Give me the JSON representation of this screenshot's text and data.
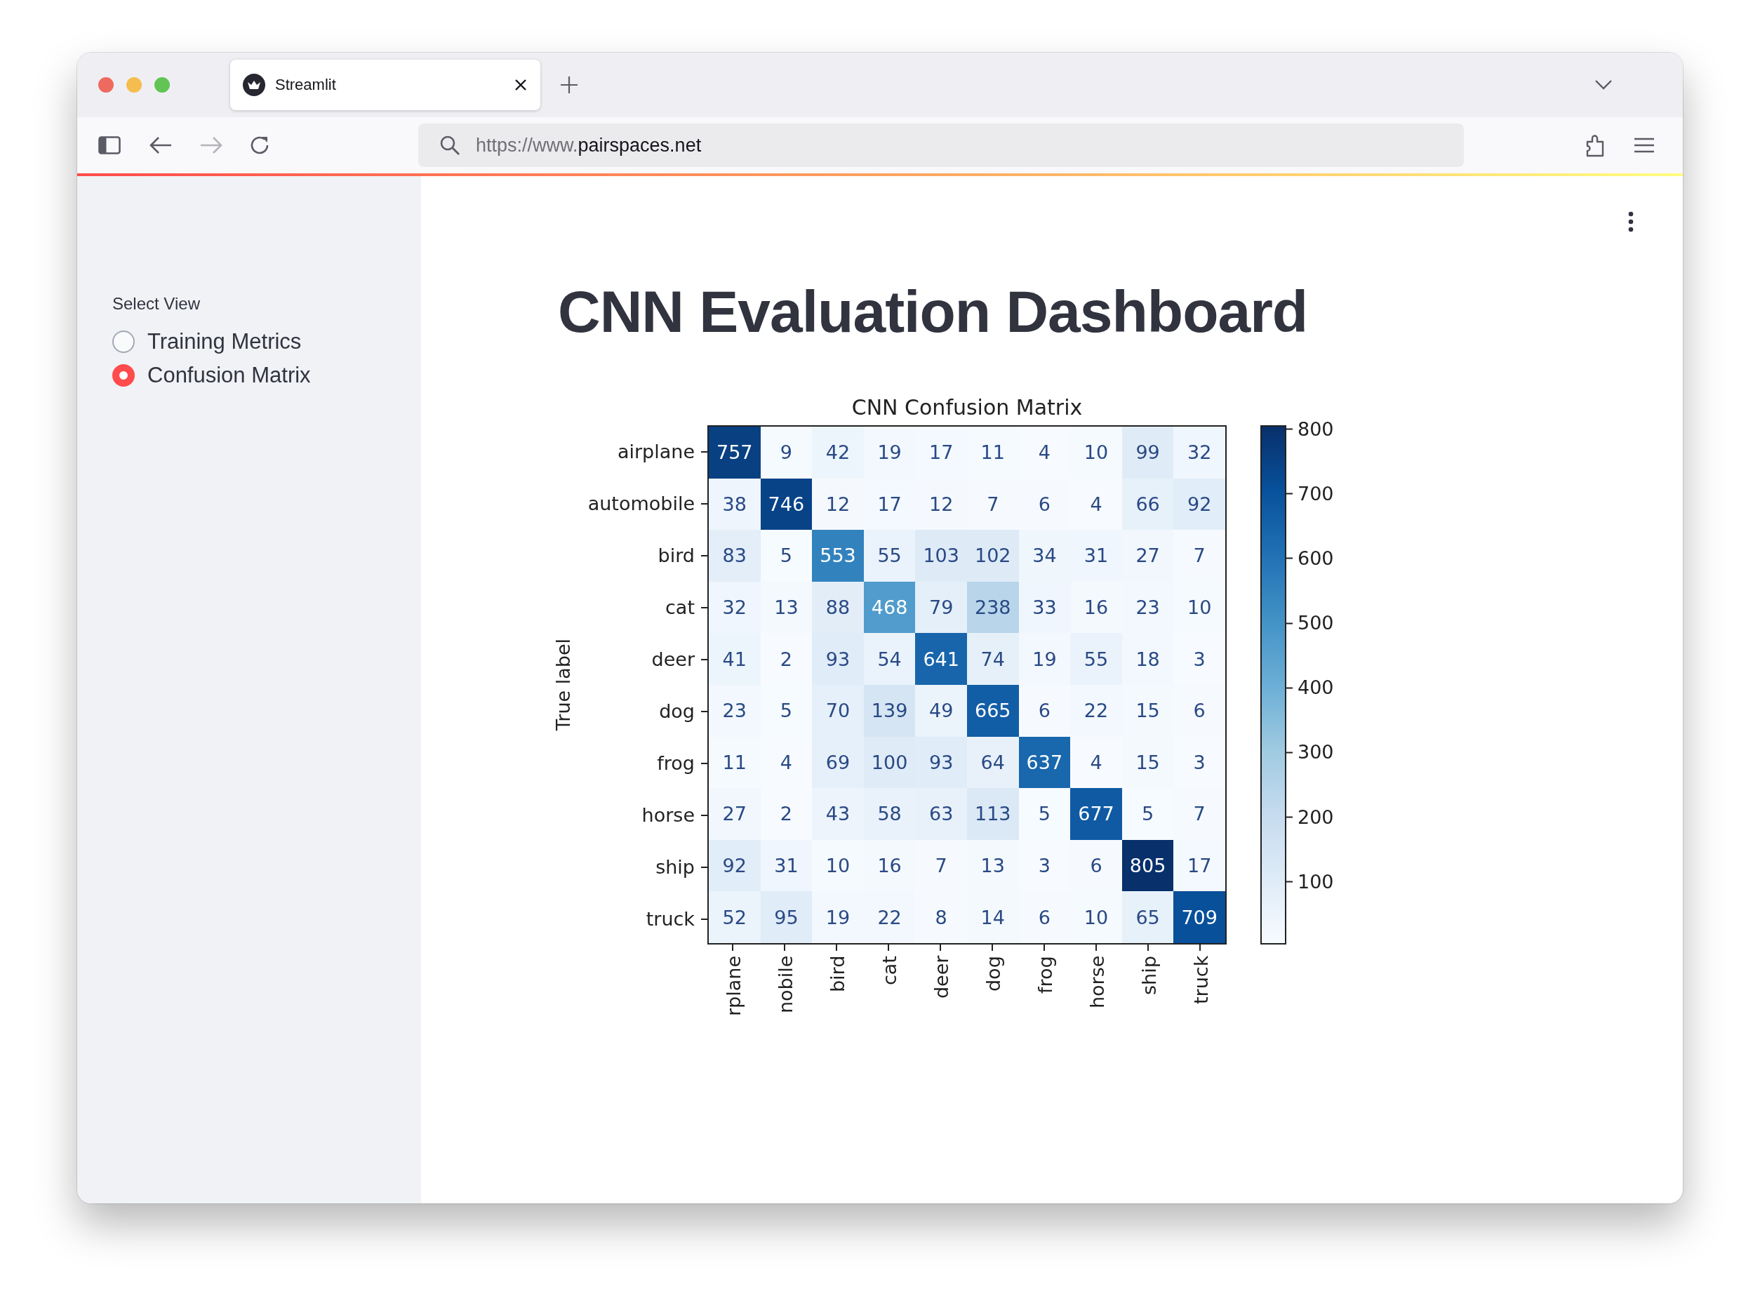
{
  "browser": {
    "tabs": [
      {
        "title": "Streamlit",
        "selected": true
      }
    ],
    "url_prefix": "https://www.",
    "url_host": "pairspaces.net"
  },
  "sidebar": {
    "label": "Select View",
    "options": [
      {
        "label": "Training Metrics",
        "selected": false
      },
      {
        "label": "Confusion Matrix",
        "selected": true
      }
    ]
  },
  "main": {
    "title": "CNN Evaluation Dashboard",
    "confusion_matrix": {
      "title": "CNN Confusion Matrix",
      "ylabel": "True label",
      "row_labels": [
        "airplane",
        "automobile",
        "bird",
        "cat",
        "deer",
        "dog",
        "frog",
        "horse",
        "ship",
        "truck"
      ],
      "column_labels": [
        "rplane",
        "nobile",
        "bird",
        "cat",
        "deer",
        "dog",
        "frog",
        "horse",
        "ship",
        "truck"
      ],
      "rows": [
        [
          "757",
          "9",
          "42",
          "19",
          "17",
          "11",
          "4",
          "10",
          "99",
          "32"
        ],
        [
          "38",
          "746",
          "12",
          "17",
          "12",
          "7",
          "6",
          "4",
          "66",
          "92"
        ],
        [
          "83",
          "5",
          "553",
          "55",
          "103",
          "102",
          "34",
          "31",
          "27",
          "7"
        ],
        [
          "32",
          "13",
          "88",
          "468",
          "79",
          "238",
          "33",
          "16",
          "23",
          "10"
        ],
        [
          "41",
          "2",
          "93",
          "54",
          "641",
          "74",
          "19",
          "55",
          "18",
          "3"
        ],
        [
          "23",
          "5",
          "70",
          "139",
          "49",
          "665",
          "6",
          "22",
          "15",
          "6"
        ],
        [
          "11",
          "4",
          "69",
          "100",
          "93",
          "64",
          "637",
          "4",
          "15",
          "3"
        ],
        [
          "27",
          "2",
          "43",
          "58",
          "63",
          "113",
          "5",
          "677",
          "5",
          "7"
        ],
        [
          "92",
          "31",
          "10",
          "16",
          "7",
          "13",
          "3",
          "6",
          "805",
          "17"
        ],
        [
          "52",
          "95",
          "19",
          "22",
          "8",
          "14",
          "6",
          "10",
          "65",
          "709"
        ]
      ],
      "colorbar_ticks": [
        "800",
        "700",
        "600",
        "500",
        "400",
        "300",
        "200",
        "100"
      ]
    }
  }
}
